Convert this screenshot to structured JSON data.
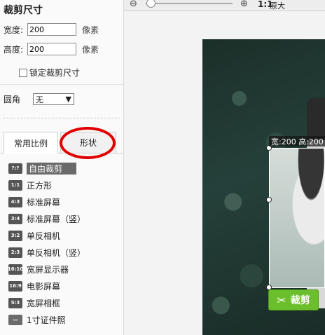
{
  "crop_size": {
    "title": "裁剪尺寸",
    "width_label": "宽度:",
    "width_value": "200",
    "height_label": "高度:",
    "height_value": "200",
    "unit": "像素",
    "lock_label": "锁定裁剪尺寸"
  },
  "corner": {
    "label": "圆角",
    "selected": "无"
  },
  "tabs": [
    {
      "label": "常用比例",
      "active": true
    },
    {
      "label": "形状",
      "active": false
    }
  ],
  "ratios": [
    {
      "badge": "?:?",
      "label": "自由裁剪",
      "selected": true
    },
    {
      "badge": "1:1",
      "label": "正方形"
    },
    {
      "badge": "4:3",
      "label": "标准屏幕"
    },
    {
      "badge": "3:4",
      "label": "标准屏幕（竖）"
    },
    {
      "badge": "3:2",
      "label": "单反相机"
    },
    {
      "badge": "2:3",
      "label": "单反相机（竖）"
    },
    {
      "badge": "16:10",
      "label": "宽屏显示器"
    },
    {
      "badge": "16:9",
      "label": "电影屏幕"
    },
    {
      "badge": "5:3",
      "label": "宽屏相框"
    },
    {
      "badge": "",
      "label": "1寸证件照"
    }
  ],
  "toolbar": {
    "zoom_original_icon": "1:1",
    "zoom_original_label": "原大"
  },
  "crop_box": {
    "dims_text": "宽:200 高:200"
  },
  "crop_button": {
    "label": "裁剪",
    "icon": "scissors-icon"
  }
}
